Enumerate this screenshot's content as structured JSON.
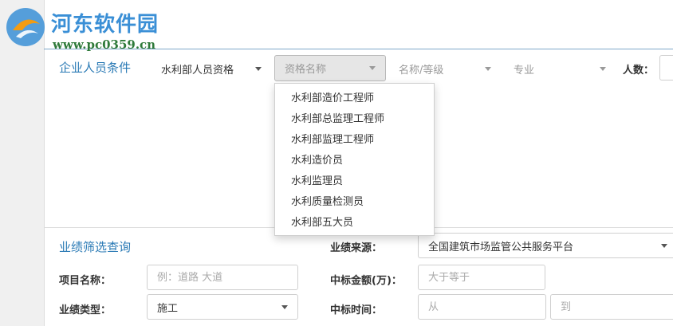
{
  "watermark": {
    "logo": "hedong-logo",
    "title": "河东软件园",
    "url": "www.pc0359.cn"
  },
  "personnel": {
    "section_title": "企业人员条件",
    "filters": {
      "ministry_qualification": "水利部人员资格",
      "qualification_name_placeholder": "资格名称",
      "name_grade_placeholder": "名称/等级",
      "specialty_placeholder": "专业",
      "count_label": "人数："
    },
    "dropdown_options": [
      "水利部造价工程师",
      "水利部总监理工程师",
      "水利部监理工程师",
      "水利造价员",
      "水利监理员",
      "水利质量检测员",
      "水利部五大员"
    ]
  },
  "performance": {
    "section_title": "业绩筛选查询",
    "project_name_label": "项目名称：",
    "project_name_placeholder": "例：道路 大道",
    "type_label": "业绩类型：",
    "type_value": "施工",
    "source_label": "业绩来源：",
    "source_value": "全国建筑市场监管公共服务平台",
    "amount_label": "中标金额(万)：",
    "amount_placeholder": "大于等于",
    "time_label": "中标时间：",
    "time_from_placeholder": "从",
    "time_to_placeholder": "到"
  },
  "colors": {
    "accent": "#2a7ab5",
    "watermark_blue": "#3a8fd6",
    "watermark_green": "#2f7a3a"
  }
}
